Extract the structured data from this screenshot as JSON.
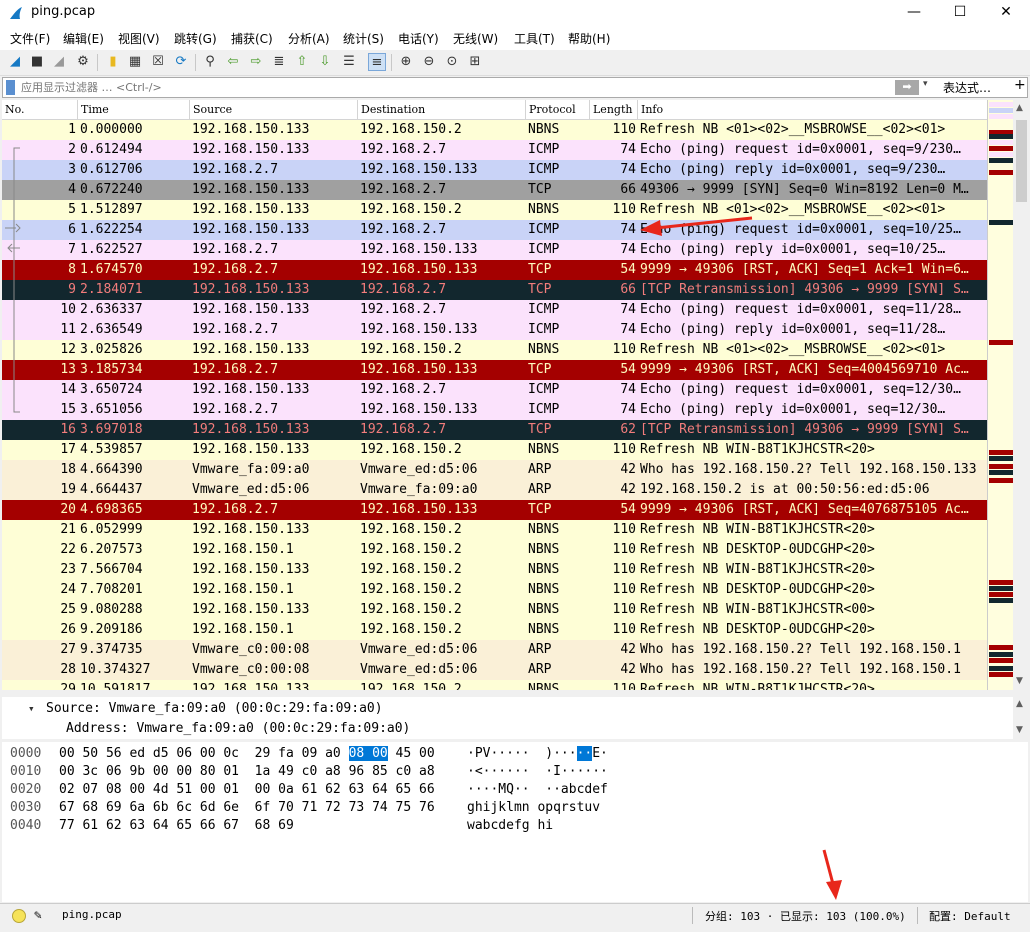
{
  "window": {
    "title": "ping.pcap",
    "minimize": "—",
    "maximize": "☐",
    "close": "✕"
  },
  "menu": [
    "文件(F)",
    "编辑(E)",
    "视图(V)",
    "跳转(G)",
    "捕获(C)",
    "分析(A)",
    "统计(S)",
    "电话(Y)",
    "无线(W)",
    "工具(T)",
    "帮助(H)"
  ],
  "filter": {
    "placeholder": "应用显示过滤器 … <Ctrl-/>",
    "arrow": "➡",
    "dropdown": "▾",
    "expression": "表达式…",
    "plus": "+"
  },
  "columns": {
    "no": "No.",
    "time": "Time",
    "source": "Source",
    "destination": "Destination",
    "protocol": "Protocol",
    "length": "Length",
    "info": "Info"
  },
  "packets": [
    {
      "no": "1",
      "time": "0.000000",
      "src": "192.168.150.133",
      "dst": "192.168.150.2",
      "proto": "NBNS",
      "len": "110",
      "info": "Refresh NB <01><02>__MSBROWSE__<02><01>",
      "style": "nbns"
    },
    {
      "no": "2",
      "time": "0.612494",
      "src": "192.168.150.133",
      "dst": "192.168.2.7",
      "proto": "ICMP",
      "len": "74",
      "info": "Echo (ping) request  id=0x0001, seq=9/230…",
      "style": "icmp"
    },
    {
      "no": "3",
      "time": "0.612706",
      "src": "192.168.2.7",
      "dst": "192.168.150.133",
      "proto": "ICMP",
      "len": "74",
      "info": "Echo (ping) reply    id=0x0001, seq=9/230…",
      "style": "icmpsel"
    },
    {
      "no": "4",
      "time": "0.672240",
      "src": "192.168.150.133",
      "dst": "192.168.2.7",
      "proto": "TCP",
      "len": "66",
      "info": "49306 → 9999 [SYN] Seq=0 Win=8192 Len=0 M…",
      "style": "tcpsyn"
    },
    {
      "no": "5",
      "time": "1.512897",
      "src": "192.168.150.133",
      "dst": "192.168.150.2",
      "proto": "NBNS",
      "len": "110",
      "info": "Refresh NB <01><02>__MSBROWSE__<02><01>",
      "style": "nbns"
    },
    {
      "no": "6",
      "time": "1.622254",
      "src": "192.168.150.133",
      "dst": "192.168.2.7",
      "proto": "ICMP",
      "len": "74",
      "info": "Echo (ping) request  id=0x0001, seq=10/25…",
      "style": "icmpsel"
    },
    {
      "no": "7",
      "time": "1.622527",
      "src": "192.168.2.7",
      "dst": "192.168.150.133",
      "proto": "ICMP",
      "len": "74",
      "info": "Echo (ping) reply    id=0x0001, seq=10/25…",
      "style": "icmp"
    },
    {
      "no": "8",
      "time": "1.674570",
      "src": "192.168.2.7",
      "dst": "192.168.150.133",
      "proto": "TCP",
      "len": "54",
      "info": "9999 → 49306 [RST, ACK] Seq=1 Ack=1 Win=6…",
      "style": "rst"
    },
    {
      "no": "9",
      "time": "2.184071",
      "src": "192.168.150.133",
      "dst": "192.168.2.7",
      "proto": "TCP",
      "len": "66",
      "info": "[TCP Retransmission] 49306 → 9999 [SYN] S…",
      "style": "retrans"
    },
    {
      "no": "10",
      "time": "2.636337",
      "src": "192.168.150.133",
      "dst": "192.168.2.7",
      "proto": "ICMP",
      "len": "74",
      "info": "Echo (ping) request  id=0x0001, seq=11/28…",
      "style": "icmp"
    },
    {
      "no": "11",
      "time": "2.636549",
      "src": "192.168.2.7",
      "dst": "192.168.150.133",
      "proto": "ICMP",
      "len": "74",
      "info": "Echo (ping) reply    id=0x0001, seq=11/28…",
      "style": "icmp"
    },
    {
      "no": "12",
      "time": "3.025826",
      "src": "192.168.150.133",
      "dst": "192.168.150.2",
      "proto": "NBNS",
      "len": "110",
      "info": "Refresh NB <01><02>__MSBROWSE__<02><01>",
      "style": "nbns"
    },
    {
      "no": "13",
      "time": "3.185734",
      "src": "192.168.2.7",
      "dst": "192.168.150.133",
      "proto": "TCP",
      "len": "54",
      "info": "9999 → 49306 [RST, ACK] Seq=4004569710 Ac…",
      "style": "rst"
    },
    {
      "no": "14",
      "time": "3.650724",
      "src": "192.168.150.133",
      "dst": "192.168.2.7",
      "proto": "ICMP",
      "len": "74",
      "info": "Echo (ping) request  id=0x0001, seq=12/30…",
      "style": "icmp"
    },
    {
      "no": "15",
      "time": "3.651056",
      "src": "192.168.2.7",
      "dst": "192.168.150.133",
      "proto": "ICMP",
      "len": "74",
      "info": "Echo (ping) reply    id=0x0001, seq=12/30…",
      "style": "icmp"
    },
    {
      "no": "16",
      "time": "3.697018",
      "src": "192.168.150.133",
      "dst": "192.168.2.7",
      "proto": "TCP",
      "len": "62",
      "info": "[TCP Retransmission] 49306 → 9999 [SYN] S…",
      "style": "retrans"
    },
    {
      "no": "17",
      "time": "4.539857",
      "src": "192.168.150.133",
      "dst": "192.168.150.2",
      "proto": "NBNS",
      "len": "110",
      "info": "Refresh NB WIN-B8T1KJHCSTR<20>",
      "style": "nbns"
    },
    {
      "no": "18",
      "time": "4.664390",
      "src": "Vmware_fa:09:a0",
      "dst": "Vmware_ed:d5:06",
      "proto": "ARP",
      "len": "42",
      "info": "Who has 192.168.150.2? Tell 192.168.150.133",
      "style": "arp"
    },
    {
      "no": "19",
      "time": "4.664437",
      "src": "Vmware_ed:d5:06",
      "dst": "Vmware_fa:09:a0",
      "proto": "ARP",
      "len": "42",
      "info": "192.168.150.2 is at 00:50:56:ed:d5:06",
      "style": "arp"
    },
    {
      "no": "20",
      "time": "4.698365",
      "src": "192.168.2.7",
      "dst": "192.168.150.133",
      "proto": "TCP",
      "len": "54",
      "info": "9999 → 49306 [RST, ACK] Seq=4076875105 Ac…",
      "style": "rst"
    },
    {
      "no": "21",
      "time": "6.052999",
      "src": "192.168.150.133",
      "dst": "192.168.150.2",
      "proto": "NBNS",
      "len": "110",
      "info": "Refresh NB WIN-B8T1KJHCSTR<20>",
      "style": "nbns"
    },
    {
      "no": "22",
      "time": "6.207573",
      "src": "192.168.150.1",
      "dst": "192.168.150.2",
      "proto": "NBNS",
      "len": "110",
      "info": "Refresh NB DESKTOP-0UDCGHP<20>",
      "style": "nbns"
    },
    {
      "no": "23",
      "time": "7.566704",
      "src": "192.168.150.133",
      "dst": "192.168.150.2",
      "proto": "NBNS",
      "len": "110",
      "info": "Refresh NB WIN-B8T1KJHCSTR<20>",
      "style": "nbns"
    },
    {
      "no": "24",
      "time": "7.708201",
      "src": "192.168.150.1",
      "dst": "192.168.150.2",
      "proto": "NBNS",
      "len": "110",
      "info": "Refresh NB DESKTOP-0UDCGHP<20>",
      "style": "nbns"
    },
    {
      "no": "25",
      "time": "9.080288",
      "src": "192.168.150.133",
      "dst": "192.168.150.2",
      "proto": "NBNS",
      "len": "110",
      "info": "Refresh NB WIN-B8T1KJHCSTR<00>",
      "style": "nbns"
    },
    {
      "no": "26",
      "time": "9.209186",
      "src": "192.168.150.1",
      "dst": "192.168.150.2",
      "proto": "NBNS",
      "len": "110",
      "info": "Refresh NB DESKTOP-0UDCGHP<20>",
      "style": "nbns"
    },
    {
      "no": "27",
      "time": "9.374735",
      "src": "Vmware_c0:00:08",
      "dst": "Vmware_ed:d5:06",
      "proto": "ARP",
      "len": "42",
      "info": "Who has 192.168.150.2? Tell 192.168.150.1",
      "style": "arp"
    },
    {
      "no": "28",
      "time": "10.374327",
      "src": "Vmware_c0:00:08",
      "dst": "Vmware_ed:d5:06",
      "proto": "ARP",
      "len": "42",
      "info": "Who has 192.168.150.2? Tell 192.168.150.1",
      "style": "arp"
    },
    {
      "no": "29",
      "time": "10.591817",
      "src": "192.168.150.133",
      "dst": "192.168.150.2",
      "proto": "NBNS",
      "len": "110",
      "info": "Refresh NB WIN-B8T1KJHCSTR<20>",
      "style": "nbns"
    }
  ],
  "details": {
    "source": "Source: Vmware_fa:09:a0 (00:0c:29:fa:09:a0)",
    "address": "Address: Vmware_fa:09:a0 (00:0c:29:fa:09:a0)"
  },
  "bytes": [
    {
      "off": "0000",
      "hex_a": "00 50 56 ed d5 06 00 0c  29 fa 09 a0 ",
      "hex_hl": "08 00",
      "hex_b": " 45 00",
      "asc_a": "·PV·····  )···",
      "asc_hl": "··",
      "asc_b": "E·"
    },
    {
      "off": "0010",
      "hex_a": "00 3c 06 9b 00 00 80 01  1a 49 c0 a8 96 85 c0 a8",
      "hex_hl": "",
      "hex_b": "",
      "asc_a": "·<······  ·I······",
      "asc_hl": "",
      "asc_b": ""
    },
    {
      "off": "0020",
      "hex_a": "02 07 08 00 4d 51 00 01  00 0a 61 62 63 64 65 66",
      "hex_hl": "",
      "hex_b": "",
      "asc_a": "····MQ··  ··abcdef",
      "asc_hl": "",
      "asc_b": ""
    },
    {
      "off": "0030",
      "hex_a": "67 68 69 6a 6b 6c 6d 6e  6f 70 71 72 73 74 75 76",
      "hex_hl": "",
      "hex_b": "",
      "asc_a": "ghijklmn opqrstuv",
      "asc_hl": "",
      "asc_b": ""
    },
    {
      "off": "0040",
      "hex_a": "77 61 62 63 64 65 66 67  68 69",
      "hex_hl": "",
      "hex_b": "",
      "asc_a": "wabcdefg hi",
      "asc_hl": "",
      "asc_b": ""
    }
  ],
  "status": {
    "file": "ping.pcap",
    "packets": "分组: 103 · 已显示: 103 (100.0%)",
    "profile": "配置: Default"
  },
  "colors": {
    "nbns": "#fefed6",
    "icmp": "#fbe2fc",
    "icmp_selected": "#c9d3f7",
    "tcp_syn": "#a0a0a0",
    "rst": "#a40000",
    "retrans": "#12272e",
    "arp": "#faf0d7",
    "annotation_arrow": "#e8271b",
    "byte_highlight": "#0078d7"
  }
}
